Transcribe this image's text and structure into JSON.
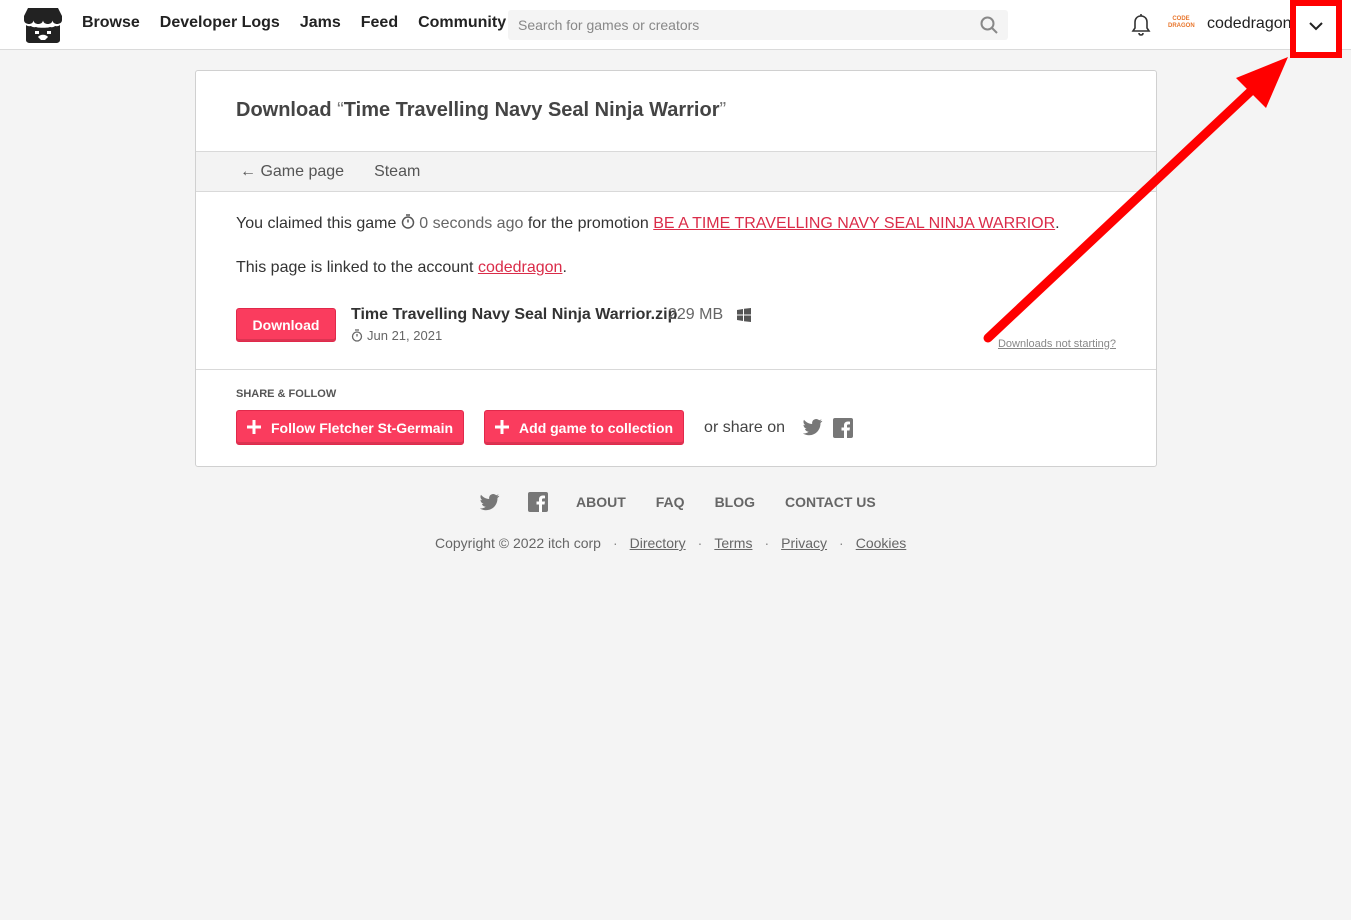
{
  "header": {
    "nav": [
      "Browse",
      "Developer Logs",
      "Jams",
      "Feed",
      "Community"
    ],
    "search_placeholder": "Search for games or creators",
    "avatar_text": "CODE DRAGON",
    "username": "codedragon"
  },
  "download": {
    "title_prefix": "Download",
    "open_quote": "“",
    "game_title": "Time Travelling Navy Seal Ninja Warrior",
    "close_quote": "”",
    "tabs": [
      "← Game page",
      "Steam"
    ],
    "claimed_prefix": "You claimed this game",
    "claimed_time": "0 seconds ago",
    "claimed_mid": "for the promotion",
    "promotion": "BE A TIME TRAVELLING NAVY SEAL NINJA WARRIOR",
    "linked_prefix": "This page is linked to the account",
    "linked_account": "codedragon",
    "download_button": "Download",
    "file_name": "Time Travelling Navy Seal Ninja Warrior.zip",
    "file_size": "229 MB",
    "file_date": "Jun 21, 2021",
    "not_starting": "Downloads not starting?"
  },
  "share": {
    "heading": "SHARE & FOLLOW",
    "follow_button": "Follow Fletcher St-Germain",
    "collection_button": "Add game to collection",
    "share_text": "or share on"
  },
  "footer": {
    "links": [
      "ABOUT",
      "FAQ",
      "BLOG",
      "CONTACT US"
    ],
    "copyright": "Copyright © 2022 itch corp",
    "legal": [
      "Directory",
      "Terms",
      "Privacy",
      "Cookies"
    ]
  },
  "colors": {
    "accent": "#fa3c5e",
    "annotation": "#ff0000"
  }
}
